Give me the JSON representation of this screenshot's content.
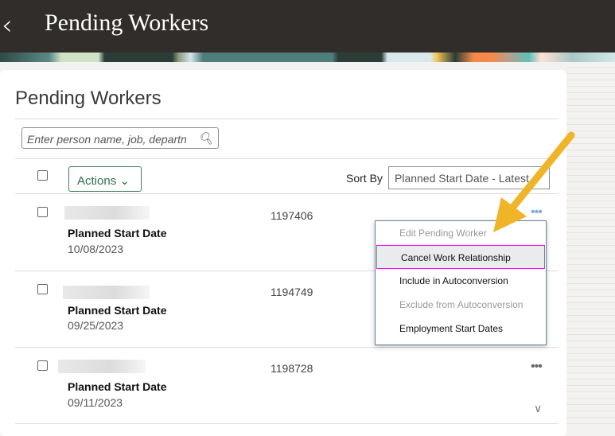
{
  "header": {
    "title": "Pending Workers"
  },
  "page": {
    "heading": "Pending Workers",
    "search_placeholder": "Enter person name, job, departn",
    "actions_label": "Actions",
    "sort_label": "Sort By",
    "sort_value": "Planned Start Date - Latest"
  },
  "rows": [
    {
      "id": "1197406",
      "date_label": "Planned Start Date",
      "date": "10/08/2023"
    },
    {
      "id": "1194749",
      "date_label": "Planned Start Date",
      "date": "09/25/2023"
    },
    {
      "id": "1198728",
      "date_label": "Planned Start Date",
      "date": "09/11/2023"
    }
  ],
  "menu": {
    "items": [
      {
        "label": "Edit Pending Worker",
        "disabled": true
      },
      {
        "label": "Cancel Work Relationship",
        "highlighted": true
      },
      {
        "label": "Include in Autoconversion"
      },
      {
        "label": "Exclude from Autoconversion",
        "disabled": true
      },
      {
        "label": "Employment Start Dates"
      }
    ]
  },
  "colors": {
    "header": "#312d2a",
    "accent": "#3e7e5f",
    "arrow": "#f0b429"
  }
}
